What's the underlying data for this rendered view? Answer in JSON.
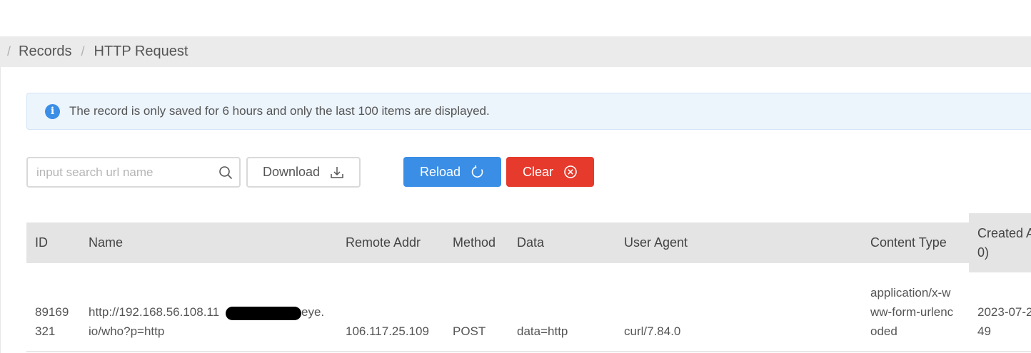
{
  "breadcrumb": {
    "separator": "/",
    "items": [
      "Records",
      "HTTP Request"
    ]
  },
  "alert": {
    "icon": "info-icon",
    "text": "The record is only saved for 6 hours and only the last 100 items are displayed."
  },
  "toolbar": {
    "search_placeholder": "input search url name",
    "download_label": "Download",
    "reload_label": "Reload",
    "clear_label": "Clear"
  },
  "colors": {
    "primary": "#3a8ee6",
    "danger": "#e63a2c",
    "alert_bg": "#ecf4fc",
    "header_bg": "#e4e4e4"
  },
  "table": {
    "headers": {
      "id": "ID",
      "name": "Name",
      "remote_addr": "Remote Addr",
      "method": "Method",
      "data": "Data",
      "user_agent": "User Agent",
      "content_type": "Content Type",
      "created_at_line1": "Created A",
      "created_at_line2": "0)"
    },
    "rows": [
      {
        "id_line1": "89169",
        "id_line2": "321",
        "name_line1_start": "http://192.168.56.108.11",
        "name_line1_end": "eye.",
        "name_line2": "io/who?p=http",
        "remote_addr": "106.117.25.109",
        "method": "POST",
        "data": "data=http",
        "user_agent": "curl/7.84.0",
        "content_type_line1": "application/x-w",
        "content_type_line2": "ww-form-urlenc",
        "content_type_line3": "oded",
        "created_at_line1": "2023-07-2",
        "created_at_line2": "49"
      }
    ]
  }
}
